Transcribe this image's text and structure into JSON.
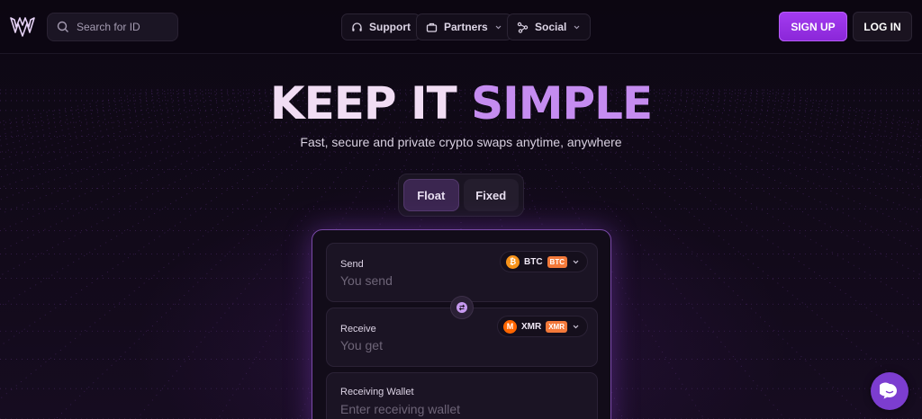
{
  "header": {
    "search_placeholder": "Search for ID",
    "nav": [
      {
        "label": "Support",
        "icon": "headset-icon"
      },
      {
        "label": "Partners",
        "icon": "briefcase-icon"
      },
      {
        "label": "Social",
        "icon": "share-icon"
      }
    ],
    "signup_label": "SIGN UP",
    "login_label": "LOG IN"
  },
  "hero": {
    "title_main": "KEEP IT ",
    "title_accent": "SIMPLE",
    "subtitle": "Fast, secure and private crypto swaps anytime, anywhere"
  },
  "rate_toggle": {
    "options": [
      "Float",
      "Fixed"
    ],
    "selected": "Float"
  },
  "exchange": {
    "send": {
      "label": "Send",
      "placeholder": "You send",
      "coin": "BTC",
      "network_tag": "BTC",
      "coin_color": "#f7931a"
    },
    "receive": {
      "label": "Receive",
      "placeholder": "You get",
      "coin": "XMR",
      "network_tag": "XMR",
      "coin_color": "#ff6600"
    },
    "wallet": {
      "label": "Receiving Wallet",
      "placeholder": "Enter receiving wallet"
    }
  },
  "colors": {
    "accent": "#a43cf0",
    "title_accent": "#c58cf0",
    "tag": "#f3793a"
  }
}
